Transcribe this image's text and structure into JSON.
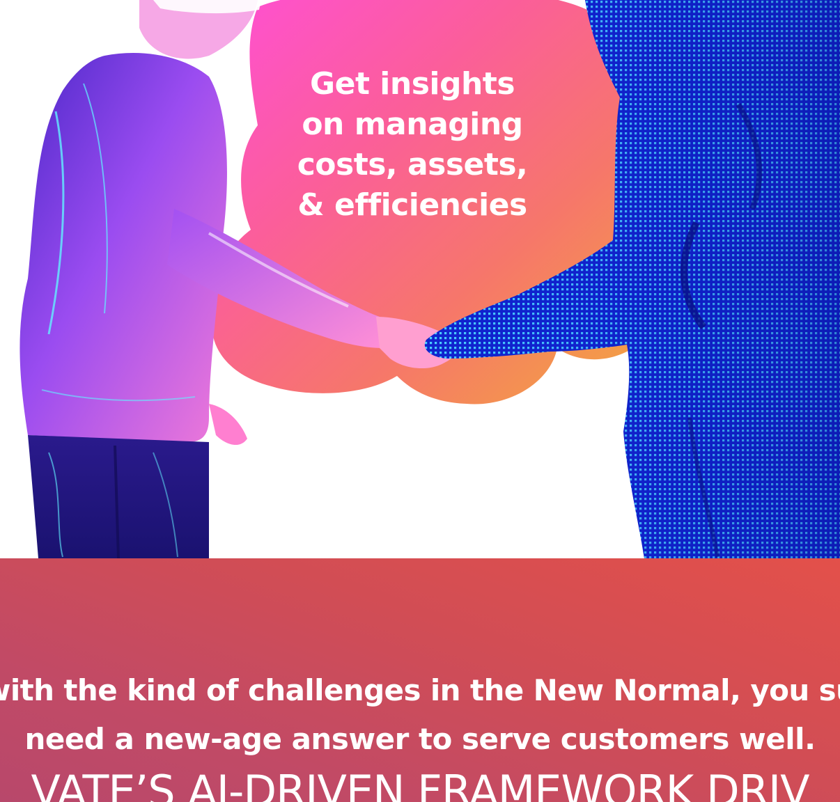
{
  "hero": {
    "title_lines": [
      "Get insights",
      "on managing",
      "costs, assets,",
      "& efficiencies"
    ]
  },
  "banner": {
    "line1": "with the kind of challenges in the New Normal, you su",
    "line2": "need a new-age answer to serve customers well.",
    "heading": "VATE’S AI-DRIVEN FRAMEWORK DRIV"
  },
  "colors": {
    "blob_pink": "#ff5fd0",
    "blob_coral": "#f76f6c",
    "blob_orange": "#f3a640",
    "robot_blue": "#1e3cf0",
    "human_purple": "#9b4df2",
    "banner_red": "#e3504a",
    "banner_rose": "#b8486b"
  }
}
